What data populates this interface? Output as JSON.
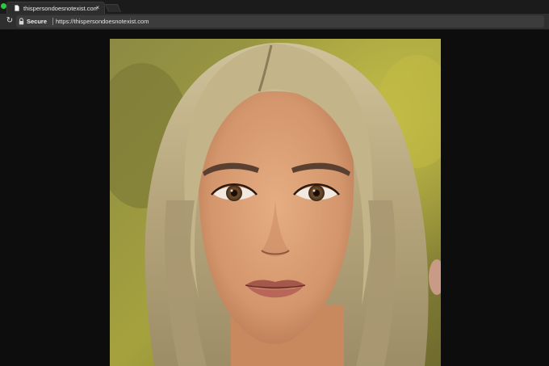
{
  "tab": {
    "title": "thispersondoesnotexist.com",
    "close_glyph": "×",
    "favicon": "page-icon"
  },
  "toolbar": {
    "reload_glyph": "↻",
    "secure_label": "Secure",
    "url": "https://thispersondoesnotexist.com",
    "lock_icon": "lock-icon"
  },
  "colors": {
    "window_button": "#2bc840",
    "page_background": "#0d0d0d"
  }
}
